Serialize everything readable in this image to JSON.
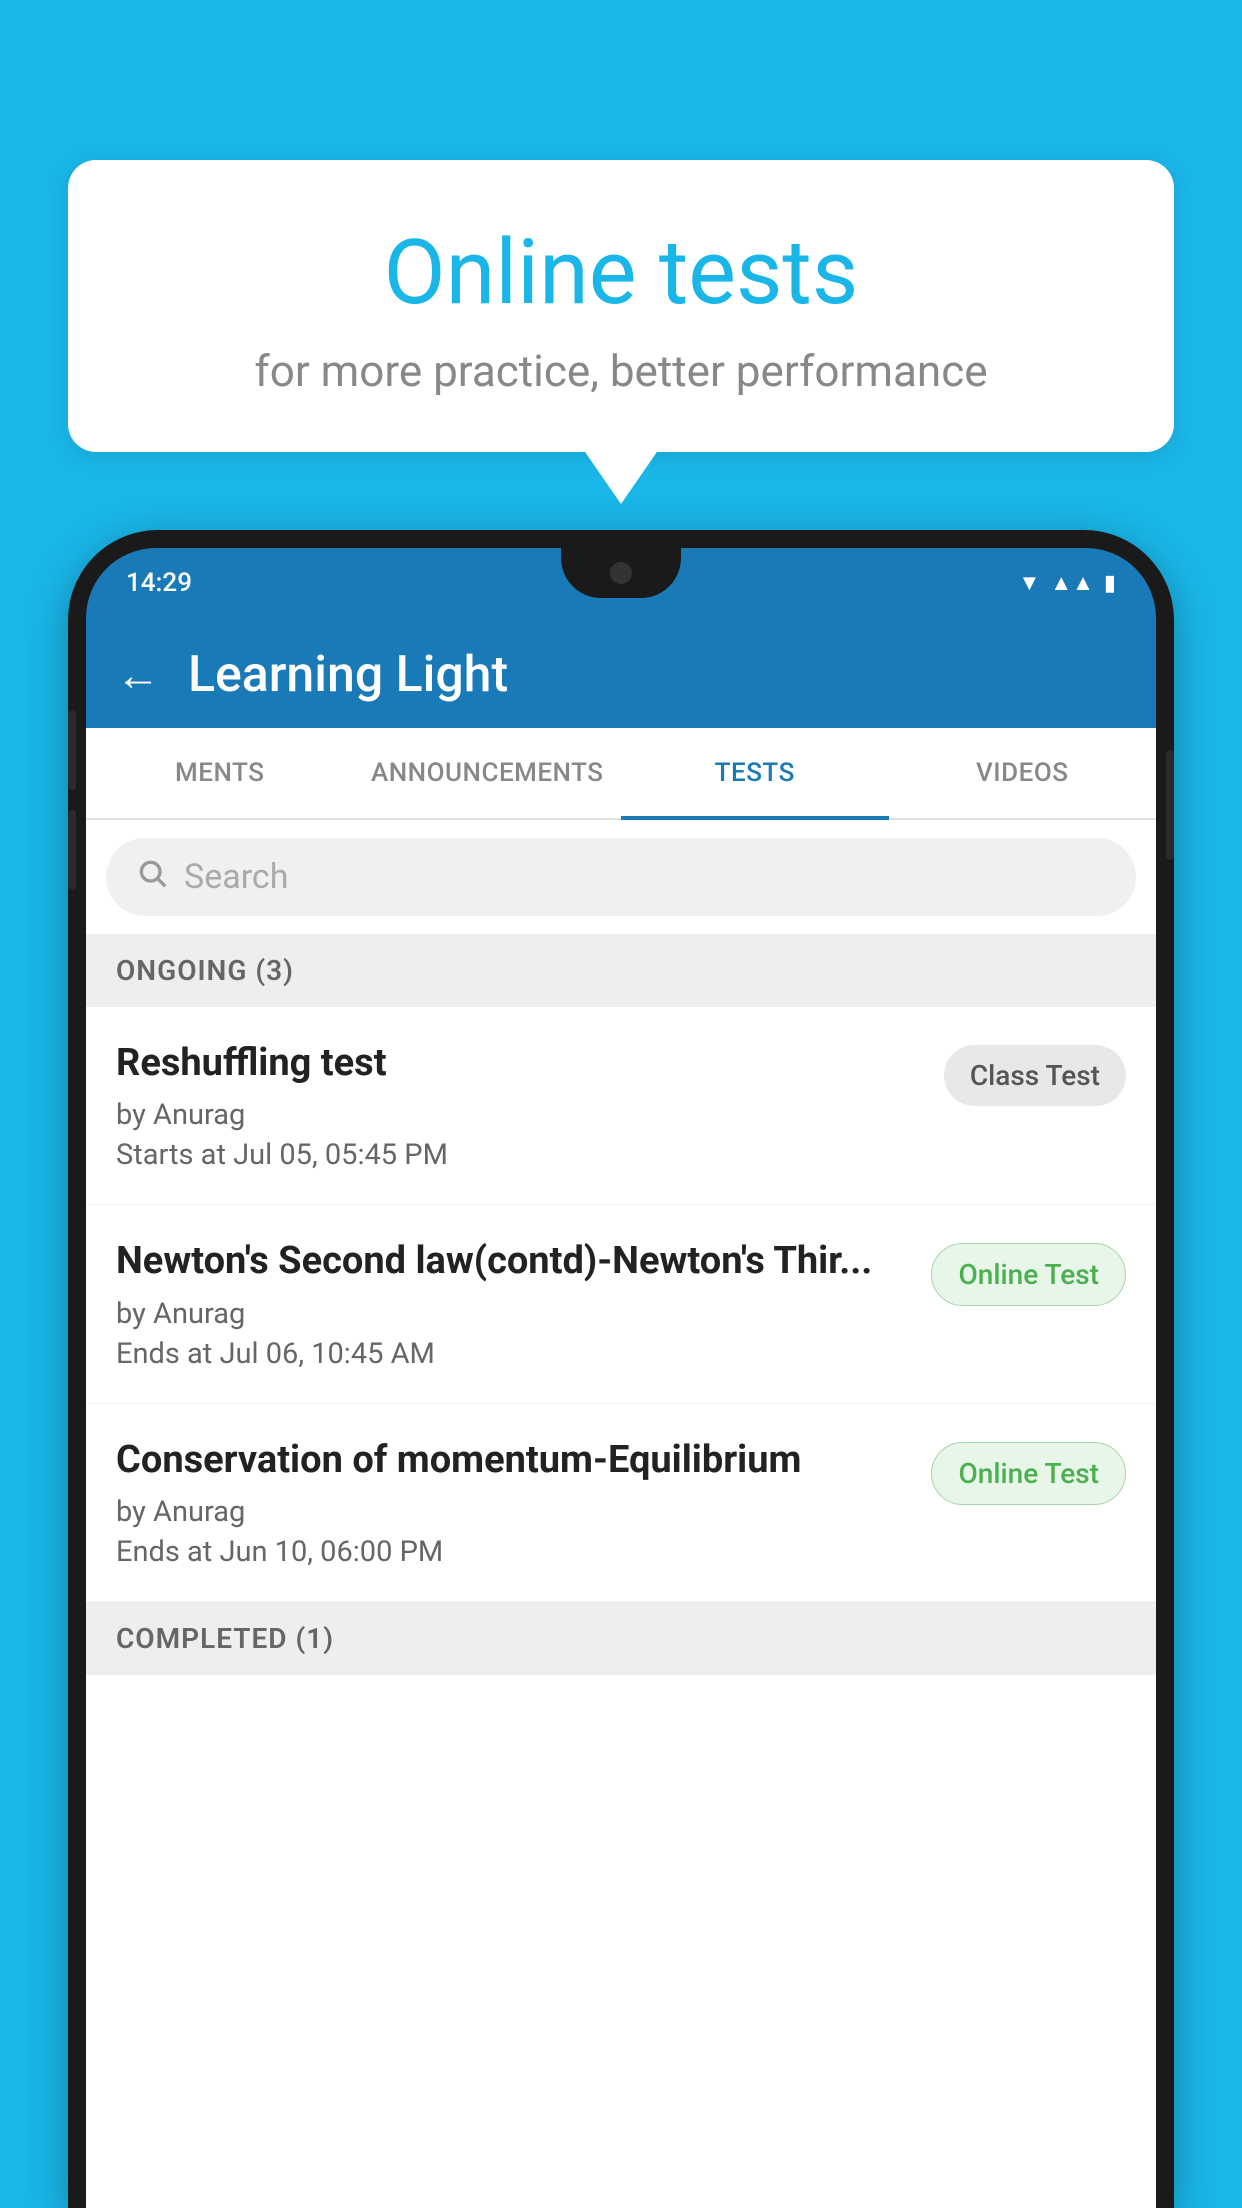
{
  "background": {
    "color": "#1ab6e8"
  },
  "bubble": {
    "title": "Online tests",
    "subtitle": "for more practice, better performance"
  },
  "phone": {
    "status_time": "14:29",
    "app_title": "Learning Light",
    "back_label": "←",
    "tabs": [
      {
        "label": "MENTS",
        "active": false
      },
      {
        "label": "ANNOUNCEMENTS",
        "active": false
      },
      {
        "label": "TESTS",
        "active": true
      },
      {
        "label": "VIDEOS",
        "active": false
      }
    ],
    "search": {
      "placeholder": "Search"
    },
    "ongoing_section": "ONGOING (3)",
    "tests": [
      {
        "name": "Reshuffling test",
        "by": "by Anurag",
        "time_label": "Starts at",
        "time": "Jul 05, 05:45 PM",
        "badge": "Class Test",
        "badge_type": "class"
      },
      {
        "name": "Newton's Second law(contd)-Newton's Thir...",
        "by": "by Anurag",
        "time_label": "Ends at",
        "time": "Jul 06, 10:45 AM",
        "badge": "Online Test",
        "badge_type": "online"
      },
      {
        "name": "Conservation of momentum-Equilibrium",
        "by": "by Anurag",
        "time_label": "Ends at",
        "time": "Jun 10, 06:00 PM",
        "badge": "Online Test",
        "badge_type": "online"
      }
    ],
    "completed_section": "COMPLETED (1)"
  }
}
